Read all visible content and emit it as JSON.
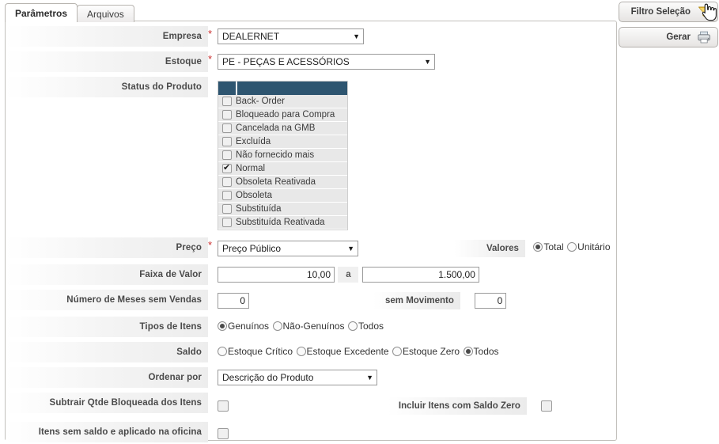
{
  "tabs": [
    {
      "label": "Parâmetros",
      "active": true
    },
    {
      "label": "Arquivos",
      "active": false
    }
  ],
  "form": {
    "empresa": {
      "label": "Empresa",
      "required": "*",
      "value": "DEALERNET",
      "arrow": "▼"
    },
    "estoque": {
      "label": "Estoque",
      "required": "*",
      "value": "PE - PEÇAS E ACESSÓRIOS",
      "arrow": "▼"
    },
    "status_produto": {
      "label": "Status do Produto",
      "items": [
        {
          "label": "Back- Order",
          "checked": false
        },
        {
          "label": "Bloqueado para Compra",
          "checked": false
        },
        {
          "label": "Cancelada na GMB",
          "checked": false
        },
        {
          "label": "Excluída",
          "checked": false
        },
        {
          "label": "Não fornecido mais",
          "checked": false
        },
        {
          "label": "Normal",
          "checked": true
        },
        {
          "label": "Obsoleta Reativada",
          "checked": false
        },
        {
          "label": "Obsoleta",
          "checked": false
        },
        {
          "label": "Substituída",
          "checked": false
        },
        {
          "label": "Substituída Reativada",
          "checked": false
        }
      ]
    },
    "preco": {
      "label": "Preço",
      "required": "*",
      "value": "Preço Público",
      "arrow": "▼"
    },
    "valores": {
      "label": "Valores",
      "options": [
        {
          "label": "Total",
          "selected": true
        },
        {
          "label": "Unitário",
          "selected": false
        }
      ]
    },
    "faixa_de_valor": {
      "label": "Faixa de Valor",
      "from": "10,00",
      "separator": "a",
      "to": "1.500,00"
    },
    "meses_sem_vendas": {
      "label": "Número de Meses sem Vendas",
      "value": "0"
    },
    "sem_movimento": {
      "label": "sem Movimento",
      "value": "0"
    },
    "tipos_de_itens": {
      "label": "Tipos de Itens",
      "options": [
        {
          "label": "Genuínos",
          "selected": true
        },
        {
          "label": "Não-Genuínos",
          "selected": false
        },
        {
          "label": "Todos",
          "selected": false
        }
      ]
    },
    "saldo": {
      "label": "Saldo",
      "options": [
        {
          "label": "Estoque Crítico",
          "selected": false
        },
        {
          "label": "Estoque Excedente",
          "selected": false
        },
        {
          "label": "Estoque Zero",
          "selected": false
        },
        {
          "label": "Todos",
          "selected": true
        }
      ]
    },
    "ordenar_por": {
      "label": "Ordenar por",
      "value": "Descrição do Produto",
      "arrow": "▼"
    },
    "subtrair_qtde": {
      "label": "Subtrair Qtde Bloqueada dos Itens",
      "checked": false
    },
    "incluir_saldo_zero": {
      "label": "Incluir Itens com Saldo Zero",
      "checked": false
    },
    "itens_sem_saldo": {
      "label": "Itens sem saldo e aplicado na oficina",
      "checked": false
    }
  },
  "actions": {
    "filtro": {
      "label": "Filtro Seleção",
      "icon": "funnel-icon"
    },
    "gerar": {
      "label": "Gerar",
      "icon": "printer-icon"
    }
  },
  "colors": {
    "list_header": "#2e5570",
    "required_asterisk": "#c92d2d",
    "funnel": "#f2c230",
    "label_text": "#4a4a4a"
  }
}
